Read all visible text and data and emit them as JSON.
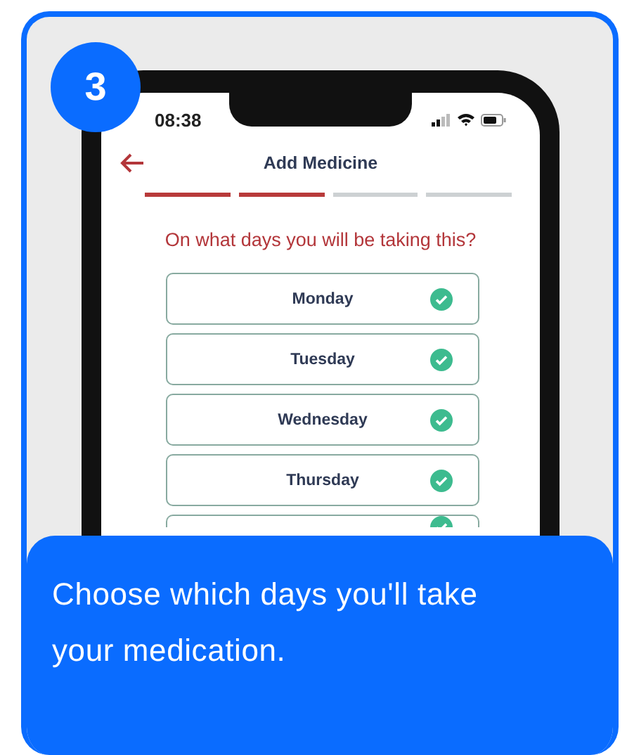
{
  "step_badge": "3",
  "phone": {
    "status_bar": {
      "time": "08:38"
    },
    "header": {
      "title": "Add Medicine"
    },
    "steps": [
      {
        "complete": true
      },
      {
        "complete": true
      },
      {
        "complete": false
      },
      {
        "complete": false
      }
    ],
    "question": "On what days you will be taking this?",
    "days": [
      {
        "label": "Monday",
        "checked": true
      },
      {
        "label": "Tuesday",
        "checked": true
      },
      {
        "label": "Wednesday",
        "checked": true
      },
      {
        "label": "Thursday",
        "checked": true
      },
      {
        "checked": true
      }
    ]
  },
  "caption": "Choose which days you'll take your medication."
}
